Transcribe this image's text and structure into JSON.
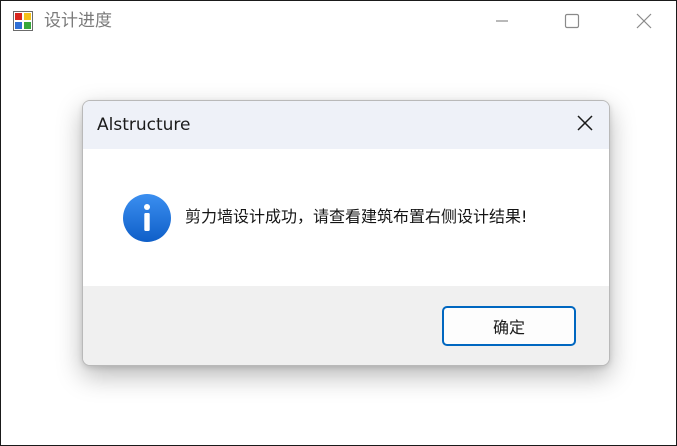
{
  "window": {
    "title": "设计进度",
    "controls": {
      "minimize_icon": "minimize-icon",
      "maximize_icon": "maximize-icon",
      "close_icon": "close-icon"
    }
  },
  "dialog": {
    "title": "Alstructure",
    "close_icon": "close-icon",
    "icon": "info-icon",
    "message": "剪力墙设计成功，请查看建筑布置右侧设计结果!",
    "ok_label": "确定"
  },
  "colors": {
    "accent": "#0067c0",
    "info_icon_blue": "#1a73d9",
    "dialog_title_bg": "#eef1f8",
    "footer_bg": "#f0f0f0"
  }
}
